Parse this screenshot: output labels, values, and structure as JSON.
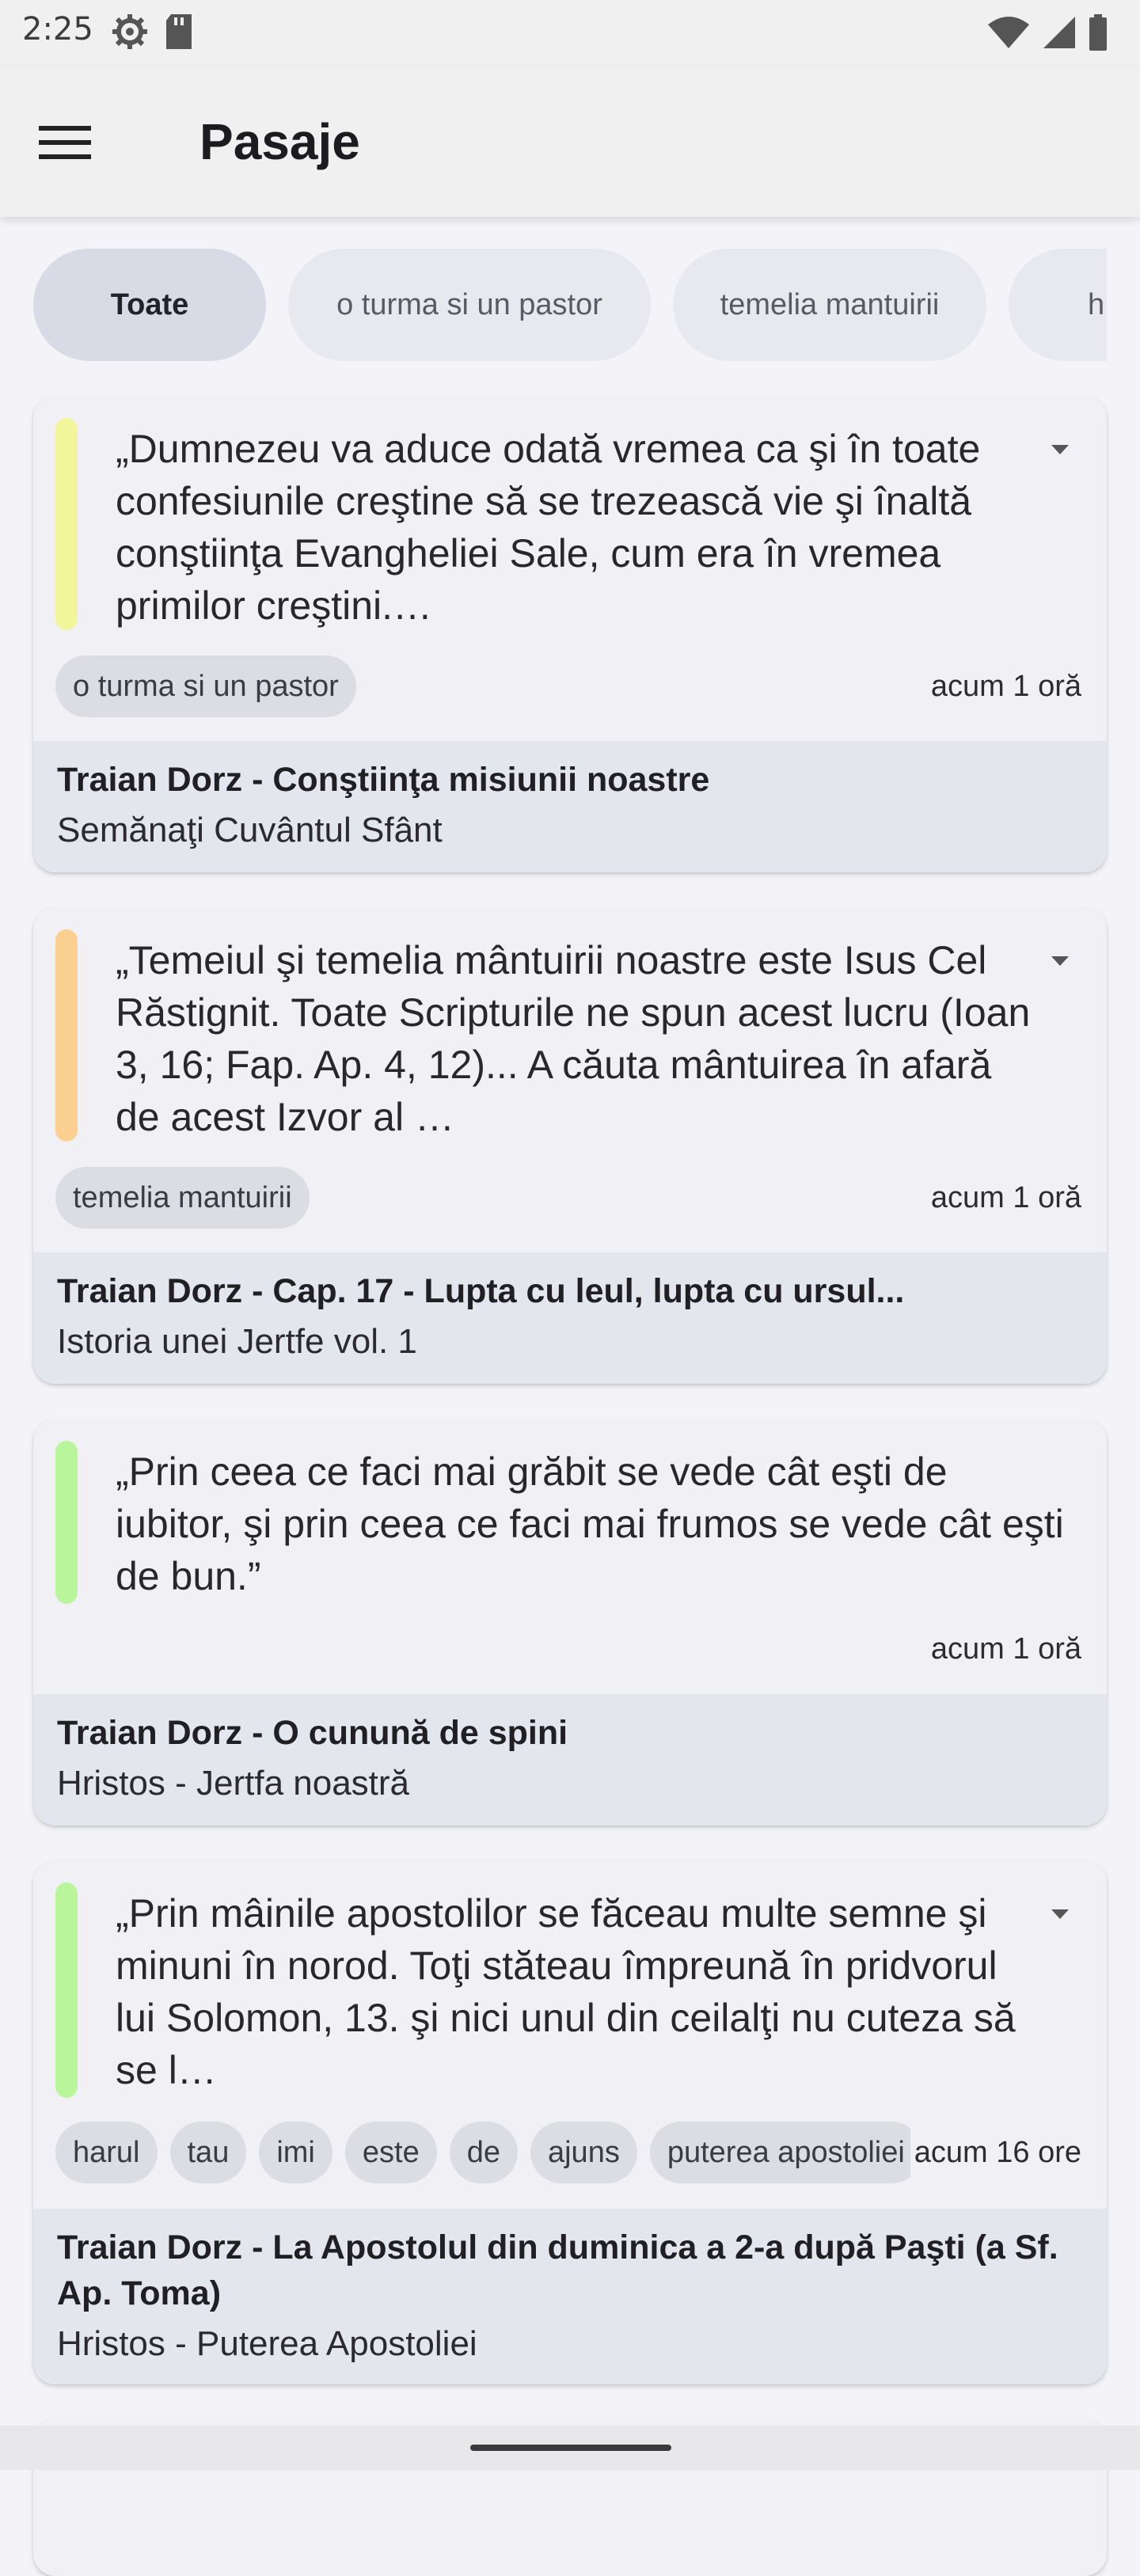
{
  "status_bar": {
    "time": "2:25",
    "icons_left": [
      "settings-icon",
      "sd-card-icon"
    ],
    "icons_right": [
      "wifi-icon",
      "signal-icon",
      "battery-icon"
    ]
  },
  "app_bar": {
    "menu_icon": "hamburger-menu-icon",
    "title": "Pasaje"
  },
  "filters": {
    "chips": [
      "Toate",
      "o turma si un pastor",
      "temelia mantuirii",
      "h"
    ],
    "selected": "Toate"
  },
  "cards": [
    {
      "accent": "#f2f59a",
      "quote": "„Dumnezeu va aduce odată vremea ca şi în toate confesiunile creştine să se trezească vie şi înaltă conştiinţa Evangheliei Sale, cum era în vremea primilor creştini.…",
      "tags": [
        "o turma si un pastor"
      ],
      "time": "acum 1 oră",
      "title": "Traian Dorz - Conştiinţa misiunii noastre",
      "subtitle": "Semănaţi Cuvântul Sfânt"
    },
    {
      "accent": "#fbcf8f",
      "quote": "„Temeiul şi temelia mântuirii noastre este Isus Cel Răstignit. Toate Scripturile ne spun acest lucru (Ioan 3, 16; Fap. Ap. 4, 12)... A căuta mântuirea în afară de acest Izvor al …",
      "tags": [
        "temelia mantuirii"
      ],
      "time": "acum 1 oră",
      "title": "Traian Dorz - Cap. 17 - Lupta cu leul, lupta cu ursul...",
      "subtitle": "Istoria unei Jertfe vol. 1"
    },
    {
      "accent": "#b9f59a",
      "quote": "„Prin ceea ce faci mai grăbit se vede cât eşti de iubitor, şi prin ceea ce faci mai frumos se vede cât eşti de bun.”",
      "tags": [],
      "time": "acum 1 oră",
      "title": "Traian Dorz - O cunună de spini",
      "subtitle": "Hristos - Jertfa noastră"
    },
    {
      "accent": "#b9f59a",
      "quote": "„Prin mâinile apostolilor se făceau multe semne şi minuni în norod. Toţi stăteau împreună în pridvorul lui Solomon, 13. şi nici unul din ceilalţi nu cuteza să se l…",
      "tags": [
        "harul",
        "tau",
        "imi",
        "este",
        "de",
        "ajuns",
        "puterea apostoliei"
      ],
      "time": "acum 16 ore",
      "title": "Traian Dorz - La Apostolul din duminica a 2-a după Paşti (a Sf. Ap. Toma)",
      "subtitle": "Hristos - Puterea Apostoliei"
    }
  ]
}
